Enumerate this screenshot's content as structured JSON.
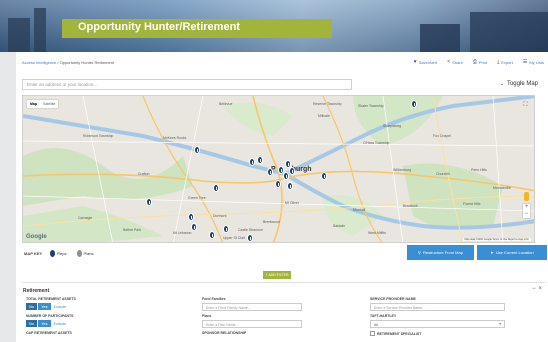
{
  "page": {
    "title": "Opportunity Hunter/Retirement"
  },
  "breadcrumb": {
    "root": "Access Intelligence",
    "current": "Opportunity Hunter Retirement"
  },
  "actions": [
    {
      "label": "Save/Alert",
      "icon": "save-icon"
    },
    {
      "label": "Share",
      "icon": "share-icon"
    },
    {
      "label": "Print",
      "icon": "print-icon"
    },
    {
      "label": "Export",
      "icon": "export-icon"
    },
    {
      "label": "My Lists",
      "icon": "list-icon"
    }
  ],
  "search": {
    "placeholder": "Enter an address or your location..."
  },
  "toggle_map": {
    "label": "Toggle Map"
  },
  "map": {
    "type_map": "Map",
    "type_satellite": "Satellite",
    "city": "Pittsburgh",
    "city_prefix": "P",
    "city_suffix": "burgh",
    "google": "Google",
    "attribution": "Map data ©2016 Google   Terms of Use   Report a map error",
    "labels": [
      "Bellevue",
      "Reserve Township",
      "Millvale",
      "Shaler Township",
      "McKees Rocks",
      "Robinson Township",
      "Sharpsburg",
      "O'Hara Township",
      "Fox Chapel",
      "Wilkinsburg",
      "Churchill",
      "Penn Hills",
      "Monroeville",
      "Crafton",
      "Carnegie",
      "Green Tree",
      "Mt Oliver",
      "Baldwin",
      "Bethel Park",
      "Dormont",
      "Munhall",
      "West Mifflin",
      "Braddock",
      "Forest Hills",
      "Mt Lebanon",
      "Brentwood",
      "Upper St Clair",
      "Castle Shannon"
    ]
  },
  "map_key": {
    "label": "MAP KEY",
    "reps": "Reps",
    "plans": "Plans"
  },
  "buttons": {
    "restructure": "Restructure From Map",
    "use_location": "Use Current Location",
    "add_filter": "+ ADD FILTER"
  },
  "section": {
    "title": "Retirement",
    "collapse": "−",
    "close": "×"
  },
  "filters": {
    "total_assets": {
      "label": "TOTAL RETIREMENT ASSETS",
      "no": "No",
      "yes": "Yes",
      "exclude": "Exclude"
    },
    "participants": {
      "label": "NUMBER OF PARTICIPANTS",
      "no": "No",
      "yes": "Yes",
      "exclude": "Exclude"
    },
    "cap_assets": {
      "label": "CAP RETIREMENT ASSETS"
    },
    "fund_families": {
      "label": "Fund Families",
      "placeholder": "Enter a Fund Family Name..."
    },
    "plans": {
      "label": "Plans",
      "placeholder": "Enter a Plan Name..."
    },
    "sponsor_rel": {
      "label": "SPONSOR RELATIONSHIP"
    },
    "provider_name": {
      "label": "SERVICE PROVIDER NAME",
      "placeholder": "Enter a Service Provider Name..."
    },
    "tpa": {
      "label": "TAFT-HARTLEY",
      "value": "All"
    },
    "specialist": {
      "label": "RETIREMENT SPECIALIST"
    }
  }
}
